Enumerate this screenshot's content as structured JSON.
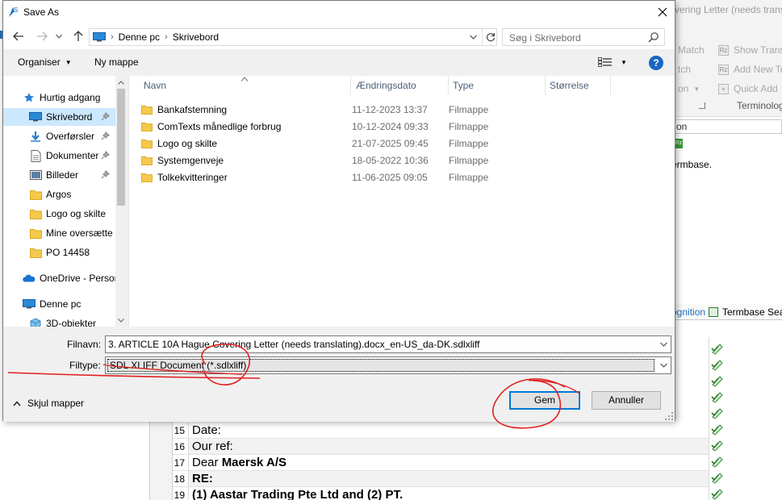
{
  "background_app": {
    "title_fragment": "vering Letter (needs translati",
    "ribbon": [
      {
        "label": "Match",
        "icon": "match-icon"
      },
      {
        "label": "Show Trans",
        "icon": "show-translation-icon"
      },
      {
        "label": "tch",
        "icon": ""
      },
      {
        "label": "Add New Te",
        "icon": "add-new-term-icon"
      },
      {
        "label": "on",
        "icon": ""
      },
      {
        "label": "Quick Add",
        "icon": "quick-add-icon"
      }
    ],
    "group_label": "Terminolog",
    "search_fragment": "on",
    "termbase_text": "ermbase.",
    "tab_recognition": "ognition",
    "tab_termbase": "Termbase Sea",
    "segments": [
      {
        "num": "15",
        "plain": "Date:",
        "bold": ""
      },
      {
        "num": "16",
        "plain": "Our ref:",
        "bold": ""
      },
      {
        "num": "17",
        "plain": "Dear ",
        "bold": "Maersk A/S"
      },
      {
        "num": "18",
        "plain": "",
        "bold": "RE:"
      },
      {
        "num": "19",
        "plain": "",
        "bold": "(1) Aastar Trading Pte Ltd and (2) PT."
      }
    ]
  },
  "dialog": {
    "title": "Save As",
    "address": {
      "segments": [
        "Denne pc",
        "Skrivebord"
      ]
    },
    "search_placeholder": "Søg i Skrivebord",
    "toolbar": {
      "organiser": "Organiser",
      "new_folder": "Ny mappe",
      "help": "?"
    },
    "nav": [
      {
        "label": "Hurtig adgang",
        "icon": "star-icon",
        "pinned": false,
        "selected": false
      },
      {
        "label": "Skrivebord",
        "icon": "desktop-icon",
        "pinned": true,
        "selected": true
      },
      {
        "label": "Overførsler",
        "icon": "download-icon",
        "pinned": true,
        "selected": false
      },
      {
        "label": "Dokumenter",
        "icon": "documents-icon",
        "pinned": true,
        "selected": false
      },
      {
        "label": "Billeder",
        "icon": "pictures-icon",
        "pinned": true,
        "selected": false
      },
      {
        "label": "Argos",
        "icon": "folder-icon",
        "pinned": false,
        "selected": false
      },
      {
        "label": "Logo og skilte",
        "icon": "folder-icon",
        "pinned": false,
        "selected": false
      },
      {
        "label": "Mine oversætte",
        "icon": "folder-icon",
        "pinned": false,
        "selected": false
      },
      {
        "label": "PO 14458",
        "icon": "folder-icon",
        "pinned": false,
        "selected": false
      },
      {
        "label": "OneDrive - Persor",
        "icon": "onedrive-icon",
        "pinned": false,
        "selected": false
      },
      {
        "label": "Denne pc",
        "icon": "computer-icon",
        "pinned": false,
        "selected": false
      },
      {
        "label": "3D-objekter",
        "icon": "3d-objects-icon",
        "pinned": false,
        "selected": false
      }
    ],
    "columns": {
      "name": "Navn",
      "date": "Ændringsdato",
      "type": "Type",
      "size": "Størrelse"
    },
    "files": [
      {
        "name": "Bankafstemning",
        "date": "11-12-2023 13:37",
        "type": "Filmappe"
      },
      {
        "name": "ComTexts månedlige forbrug",
        "date": "10-12-2024 09:33",
        "type": "Filmappe"
      },
      {
        "name": "Logo og skilte",
        "date": "21-07-2025 09:45",
        "type": "Filmappe"
      },
      {
        "name": "Systemgenveje",
        "date": "18-05-2022 10:36",
        "type": "Filmappe"
      },
      {
        "name": "Tolkekvitteringer",
        "date": "11-06-2025 09:05",
        "type": "Filmappe"
      }
    ],
    "filename_label": "Filnavn:",
    "filename_value": "3. ARTICLE 10A Hague Covering Letter (needs translating).docx_en-US_da-DK.sdlxliff",
    "filetype_label": "Filtype:",
    "filetype_value": "SDL XLIFF Document (*.sdlxliff)",
    "hide_folders": "Skjul mapper",
    "save_button": "Gem",
    "cancel_button": "Annuller"
  },
  "colors": {
    "selection": "#cce8ff",
    "primary_border": "#0078d7",
    "annotation": "#e0201f",
    "folder": "#f5c94c"
  }
}
